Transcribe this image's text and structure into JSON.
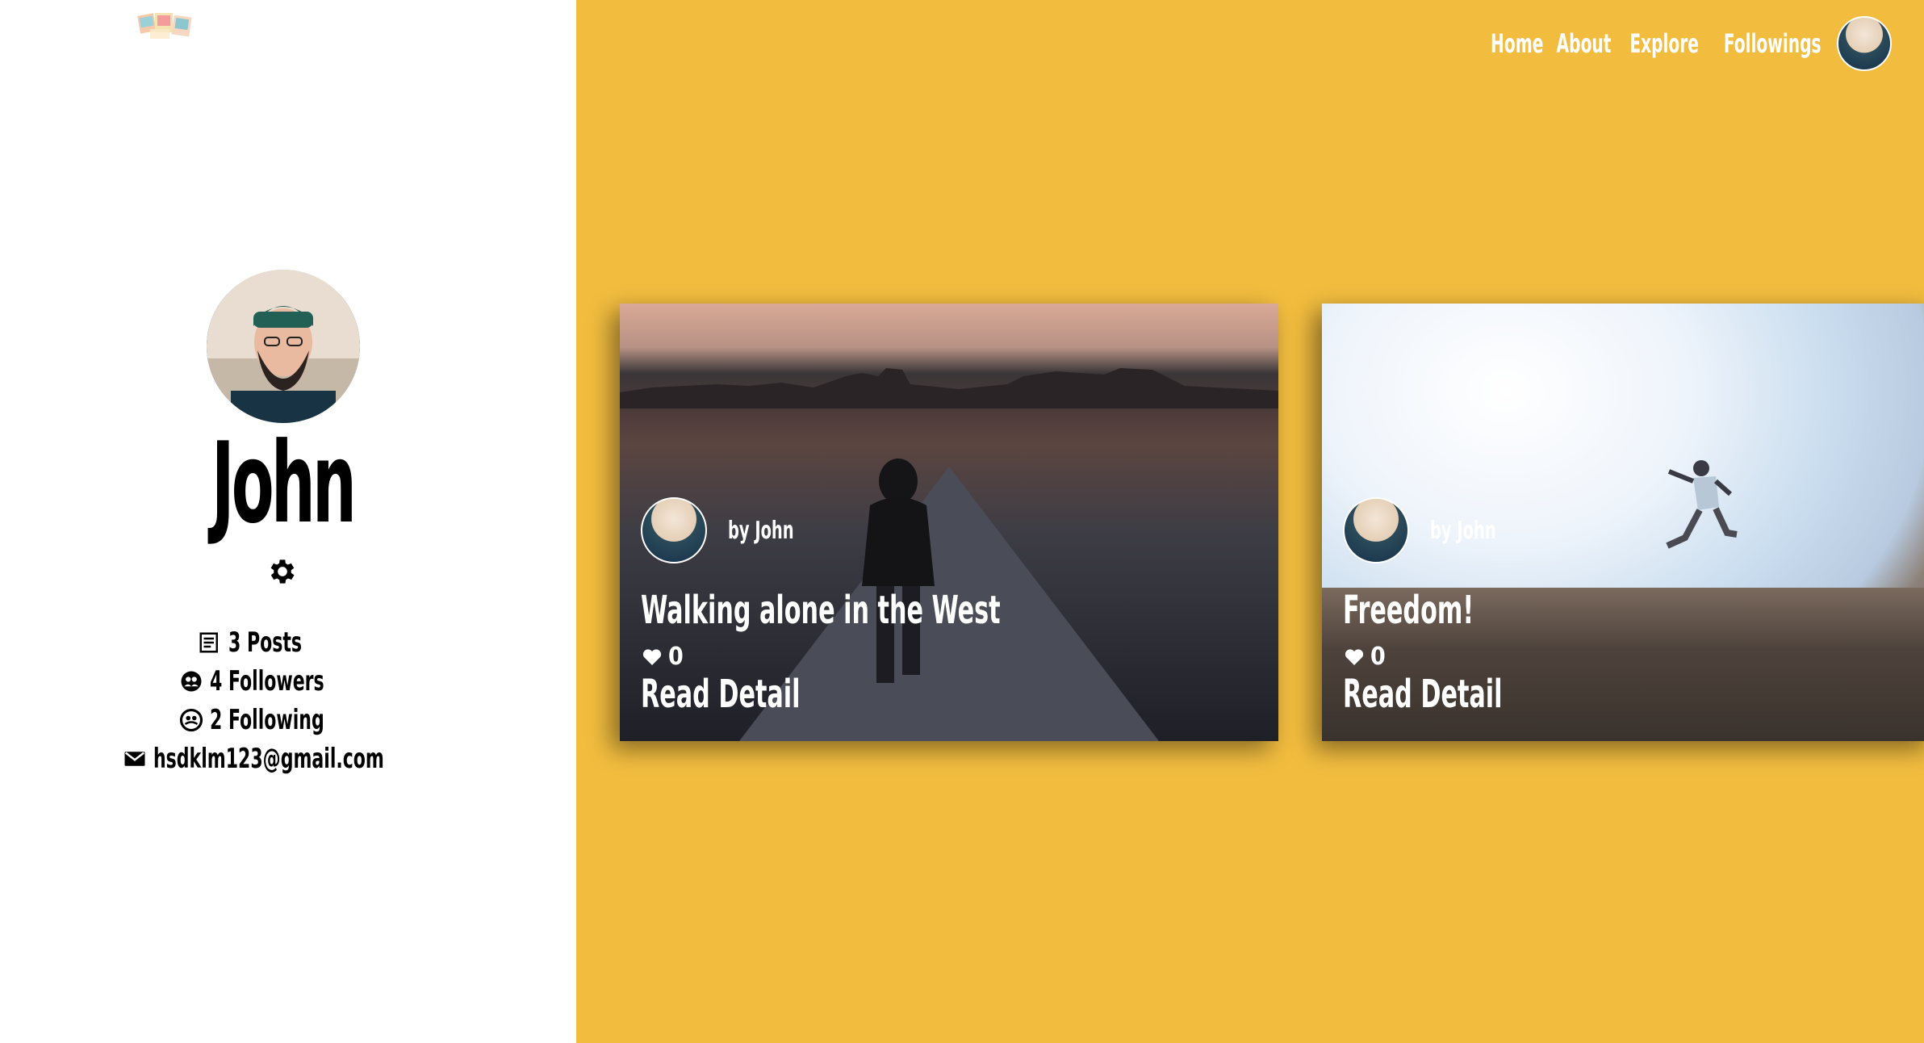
{
  "nav": {
    "links": [
      "Home",
      "About",
      "Explore",
      "Followings"
    ]
  },
  "profile": {
    "name": "John",
    "stats": {
      "posts": "3 Posts",
      "followers": "4 Followers",
      "following": "2 Following",
      "email": "hsdklm123@gmail.com"
    }
  },
  "posts": [
    {
      "author": "by John",
      "title": "Walking alone in the West",
      "likes": "0",
      "read_label": "Read Detail"
    },
    {
      "author": "by John",
      "title": "Freedom!",
      "likes": "0",
      "read_label": "Read Detail"
    }
  ],
  "colors": {
    "background_accent": "#f2bd3f",
    "panel": "#ffffff",
    "text_dark": "#000000",
    "text_light": "#ffffff"
  },
  "icons": {
    "settings": "gear-icon",
    "posts": "newspaper-icon",
    "followers": "followers-icon",
    "following": "following-icon",
    "email": "envelope-icon",
    "likes": "heart-icon"
  }
}
